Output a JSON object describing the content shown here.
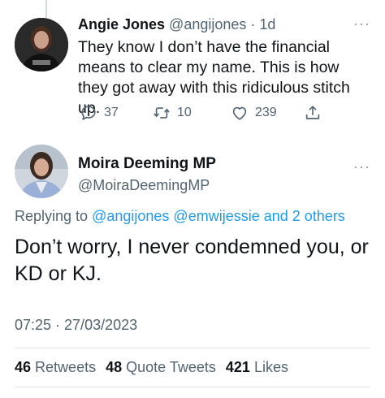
{
  "parent_tweet": {
    "author_name": "Angie Jones",
    "author_handle": "@angijones",
    "separator": "·",
    "time_ago": "1d",
    "text": "They know I don’t have the financial means to clear my name. This is how they got away with this ridiculous stitch up.",
    "more_glyph": "···",
    "actions": {
      "reply_icon": "reply-icon",
      "reply_count": "37",
      "retweet_icon": "retweet-icon",
      "retweet_count": "10",
      "like_icon": "heart-icon",
      "like_count": "239",
      "share_icon": "share-icon"
    }
  },
  "main_tweet": {
    "author_name": "Moira Deeming MP",
    "author_handle": "@MoiraDeemingMP",
    "more_glyph": "···",
    "replying_prefix": "Replying to ",
    "replying_to": [
      "@angijones",
      "@emwijessie",
      "and 2 others"
    ],
    "text": "Don’t worry, I never condemned you, or KD or KJ.",
    "timestamp": "07:25 · 27/03/2023",
    "stats": [
      {
        "count": "46",
        "label": "Retweets"
      },
      {
        "count": "48",
        "label": "Quote Tweets"
      },
      {
        "count": "421",
        "label": "Likes"
      }
    ]
  },
  "colors": {
    "text": "#0f1419",
    "secondary": "#536471",
    "link": "#1d9bf0",
    "divider": "#e1e8ed"
  }
}
